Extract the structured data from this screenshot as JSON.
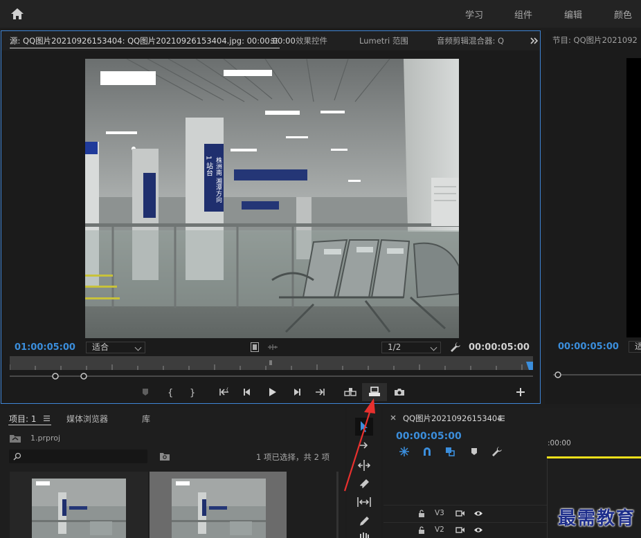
{
  "workspace": {
    "items": [
      "学习",
      "组件",
      "编辑",
      "颜色"
    ]
  },
  "source": {
    "tabs": {
      "source": "源: QQ图片20210926153404: QQ图片20210926153404.jpg: 00:00:00:00",
      "effects": "效果控件",
      "lumetri": "Lumetri 范围",
      "audio_mixer": "音频剪辑混合器: Q"
    },
    "timecode_left": "01:00:05:00",
    "fit": "适合",
    "resolution": "1/2",
    "timecode_right": "00:00:05:00",
    "viewer_signs": {
      "platform": "1 站台",
      "direction": "株洲南 湘潭方向"
    }
  },
  "program": {
    "title": "节目: QQ图片2021092",
    "timecode": "00:00:05:00",
    "dropdown": "适"
  },
  "project": {
    "tabs": {
      "project": "项目: 1",
      "media_browser": "媒体浏览器",
      "library": "库"
    },
    "file": "1.prproj",
    "search_placeholder": "",
    "selection_status": "1 项已选择，共 2 项"
  },
  "timeline": {
    "sequence_name": "QQ图片20210926153404",
    "timecode": "00:00:05:00",
    "ruler_start": ":00:00",
    "tracks": [
      "V3",
      "V2"
    ]
  },
  "watermark": "最需教育",
  "colors": {
    "accent_blue": "#3b8edc",
    "playhead_yellow": "#f2e11b",
    "annotation_red": "#e8302e"
  }
}
